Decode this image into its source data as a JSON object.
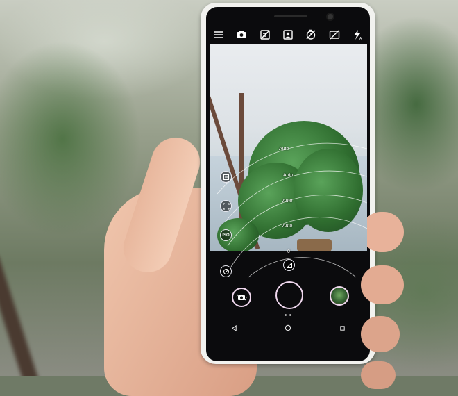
{
  "top_icons": [
    {
      "name": "menu-icon"
    },
    {
      "name": "photo-mode-icon"
    },
    {
      "name": "beauty-off-icon"
    },
    {
      "name": "portrait-icon"
    },
    {
      "name": "timer-off-icon"
    },
    {
      "name": "hdr-off-icon"
    },
    {
      "name": "flash-auto-icon"
    }
  ],
  "manual_controls": {
    "white_balance": "Auto",
    "focus": "Auto",
    "iso": "Auto",
    "shutter_speed": "Auto",
    "exposure": "0",
    "iso_label": "ISO"
  },
  "accent_color": "#e4c7f0"
}
